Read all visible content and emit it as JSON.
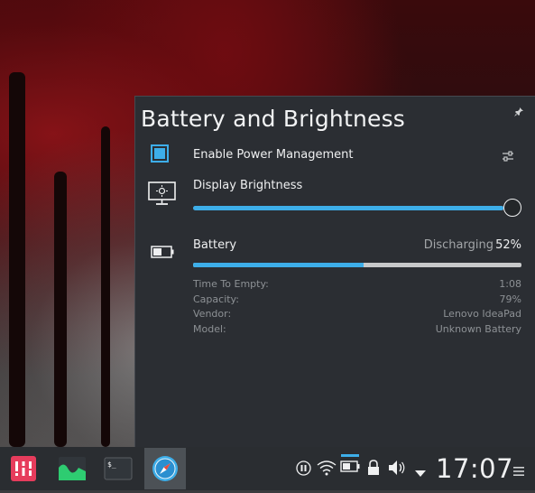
{
  "popup": {
    "title": "Battery and Brightness",
    "power_management": {
      "label": "Enable Power Management",
      "checked": true
    },
    "brightness": {
      "label": "Display Brightness",
      "level": 0.97
    },
    "battery": {
      "label": "Battery",
      "state": "Discharging",
      "percent_text": "52%",
      "percent": 52,
      "details": [
        {
          "key": "Time To Empty:",
          "value": "1:08"
        },
        {
          "key": "Capacity:",
          "value": "79%"
        },
        {
          "key": "Vendor:",
          "value": "Lenovo IdeaPad"
        },
        {
          "key": "Model:",
          "value": "Unknown Battery"
        }
      ]
    }
  },
  "taskbar": {
    "apps": [
      "app-launcher-icon",
      "system-monitor-icon",
      "terminal-icon",
      "browser-icon"
    ],
    "tray": [
      "media-pause-icon",
      "wifi-icon",
      "battery-icon",
      "lock-icon",
      "volume-icon",
      "tray-expand-icon"
    ],
    "clock": "17:07"
  },
  "colors": {
    "accent": "#3daee9",
    "panel": "#2b2e33",
    "taskbar": "#2a2d31"
  }
}
